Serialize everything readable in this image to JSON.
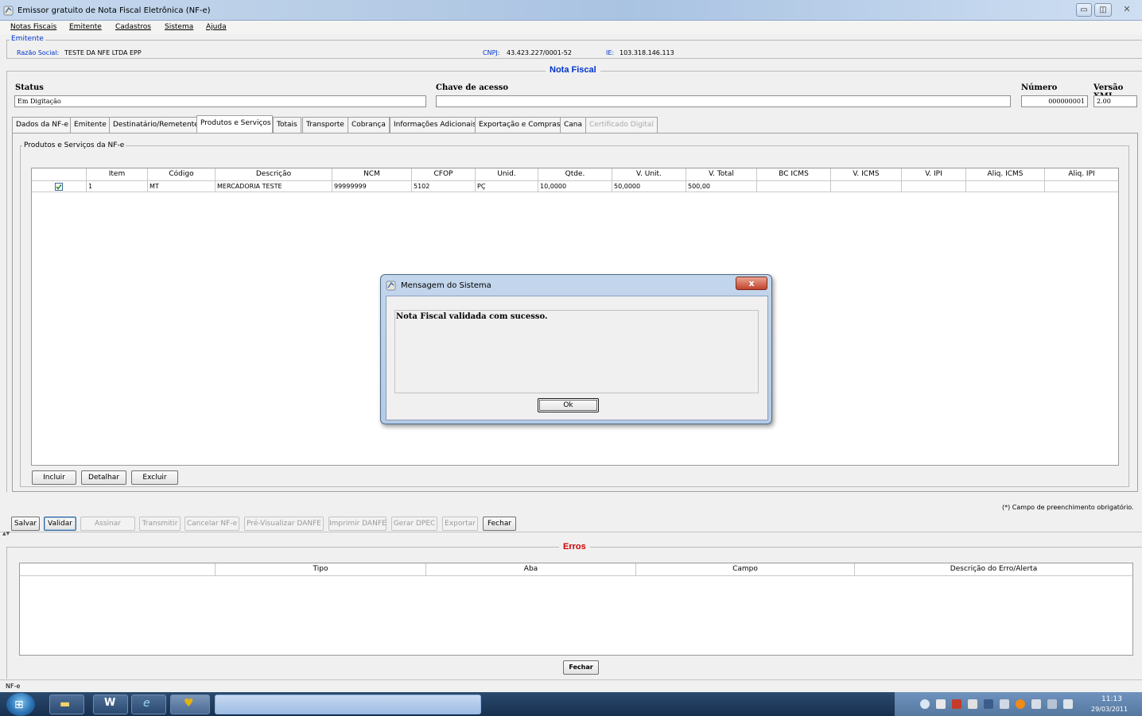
{
  "window": {
    "title": "Emissor gratuito de Nota Fiscal Eletrônica (NF-e)"
  },
  "menu": [
    "Notas Fiscais",
    "Emitente",
    "Cadastros",
    "Sistema",
    "Ajuda"
  ],
  "emitente": {
    "group_title": "Emitente",
    "razao_label": "Razão Social:",
    "razao_value": "TESTE DA NFE LTDA EPP",
    "cnpj_label": "CNPJ:",
    "cnpj_value": "43.423.227/0001-52",
    "ie_label": "IE:",
    "ie_value": "103.318.146.113"
  },
  "nota": {
    "section_title": "Nota Fiscal",
    "status_label": "Status",
    "status_value": "Em Digitação",
    "chave_label": "Chave de acesso",
    "chave_value": "",
    "numero_label": "Número",
    "numero_value": "000000001",
    "versao_label": "Versão XML",
    "versao_value": "2.00"
  },
  "tabs": [
    {
      "label": "Dados da NF-e"
    },
    {
      "label": "Emitente"
    },
    {
      "label": "Destinatário/Remetente"
    },
    {
      "label": "Produtos e Serviços"
    },
    {
      "label": "Totais"
    },
    {
      "label": "Transporte"
    },
    {
      "label": "Cobrança"
    },
    {
      "label": "Informações Adicionais"
    },
    {
      "label": "Exportação e Compras"
    },
    {
      "label": "Cana"
    },
    {
      "label": "Certificado Digital"
    }
  ],
  "produtos": {
    "group_title": "Produtos e Serviços da NF-e",
    "columns": [
      "Item",
      "Código",
      "Descrição",
      "NCM",
      "CFOP",
      "Unid.",
      "Qtde.",
      "V. Unit.",
      "V. Total",
      "BC ICMS",
      "V. ICMS",
      "V. IPI",
      "Aliq. ICMS",
      "Aliq. IPI"
    ],
    "rows": [
      {
        "checked": true,
        "cells": [
          "1",
          "MT",
          "MERCADORIA TESTE",
          "99999999",
          "5102",
          "PÇ",
          "10,0000",
          "50,0000",
          "500,00",
          "",
          "",
          "",
          "",
          ""
        ]
      }
    ],
    "buttons": {
      "incluir": "Incluir",
      "detalhar": "Detalhar",
      "excluir": "Excluir"
    }
  },
  "required_note": "(*) Campo de preenchimento obrigatório.",
  "actions": {
    "salvar": "Salvar",
    "validar": "Validar",
    "assinar": "Assinar",
    "transmitir": "Transmitir",
    "cancelar": "Cancelar NF-e",
    "previsualizar": "Pré-Visualizar DANFE",
    "imprimir": "Imprimir DANFE",
    "gerar_dpec": "Gerar DPEC",
    "exportar": "Exportar",
    "fechar": "Fechar"
  },
  "erros": {
    "section_title": "Erros",
    "columns": [
      "Tipo",
      "Aba",
      "Campo",
      "Descrição do Erro/Alerta"
    ],
    "fechar": "Fechar"
  },
  "statusbar": "NF-e",
  "dialog": {
    "title": "Mensagem do Sistema",
    "message": "Nota Fiscal validada com sucesso.",
    "ok": "Ok",
    "close_glyph": "x"
  },
  "taskbar": {
    "time": "11:13",
    "date": "29/03/2011"
  },
  "colors": {
    "group_blue": "#0033cc",
    "section_title_blue": "#0033cc",
    "erros_red": "#cc0000"
  }
}
